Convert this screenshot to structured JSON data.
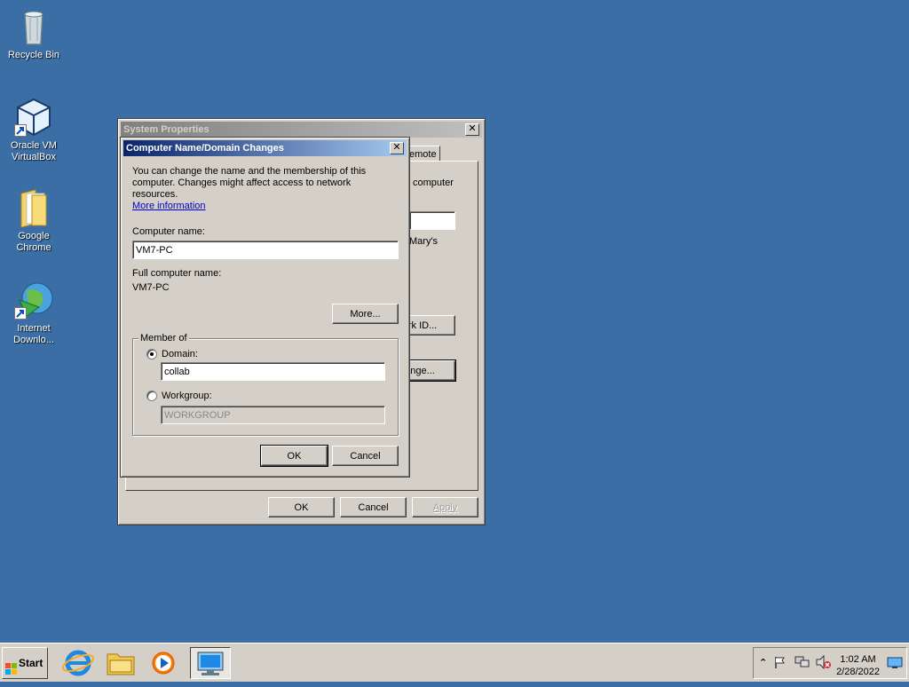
{
  "desktop": {
    "icons": [
      {
        "label": "Recycle Bin"
      },
      {
        "label": "Oracle VM VirtualBox"
      },
      {
        "label": "Google Chrome"
      },
      {
        "label": "Internet Downlo..."
      }
    ]
  },
  "system_properties": {
    "title": "System Properties",
    "tab_remote": "emote",
    "text_computer": "computer",
    "text_marys": "Mary's",
    "network_id_button": "ork ID...",
    "change_button": "ange...",
    "ok_label": "OK",
    "cancel_label": "Cancel",
    "apply_label": "Apply"
  },
  "dialog": {
    "title": "Computer Name/Domain Changes",
    "description": "You can change the name and the membership of this computer. Changes might affect access to network resources.",
    "more_info_link": "More information",
    "computer_name_label": "Computer name:",
    "computer_name_value": "VM7-PC",
    "full_name_label": "Full computer name:",
    "full_name_value": "VM7-PC",
    "more_button": "More...",
    "member_of_label": "Member of",
    "domain_label": "Domain:",
    "domain_value": "collab",
    "workgroup_label": "Workgroup:",
    "workgroup_value": "WORKGROUP",
    "selected": "domain",
    "ok_label": "OK",
    "cancel_label": "Cancel"
  },
  "taskbar": {
    "start_label": "Start",
    "clock_time": "1:02 AM",
    "clock_date": "2/28/2022"
  }
}
